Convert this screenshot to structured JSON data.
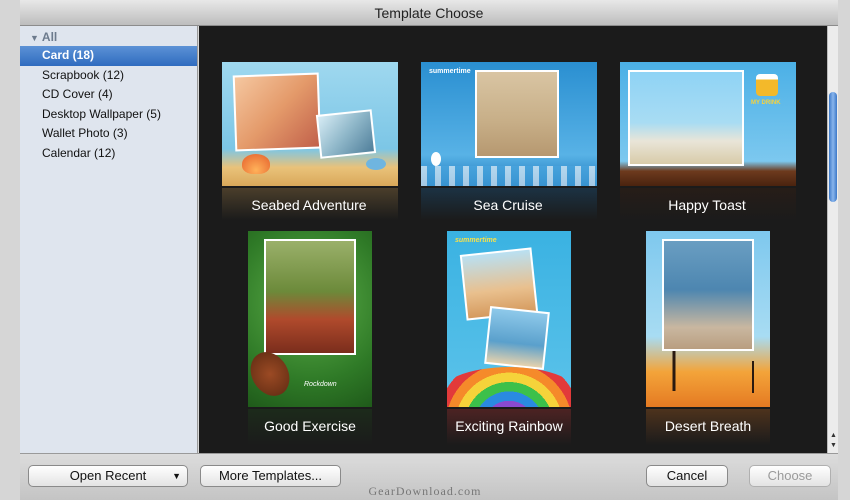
{
  "window": {
    "title": "Template Choose"
  },
  "sidebar": {
    "group_label": "All",
    "items": [
      {
        "label": "Card (18)",
        "selected": true
      },
      {
        "label": "Scrapbook (12)"
      },
      {
        "label": "CD Cover (4)"
      },
      {
        "label": "Desktop Wallpaper (5)"
      },
      {
        "label": "Wallet Photo (3)"
      },
      {
        "label": "Calendar (12)"
      }
    ]
  },
  "templates": [
    {
      "label": "Seabed Adventure"
    },
    {
      "label": "Sea Cruise",
      "text": "summertime"
    },
    {
      "label": "Happy Toast",
      "text": "MY DRINK"
    },
    {
      "label": "Good Exercise",
      "text": "Rockdown"
    },
    {
      "label": "Exciting Rainbow",
      "text": "summertime"
    },
    {
      "label": "Desert Breath"
    }
  ],
  "buttons": {
    "open_recent": "Open Recent",
    "more_templates": "More Templates...",
    "cancel": "Cancel",
    "choose": "Choose"
  },
  "watermark": "GearDownload.com",
  "colors": {
    "selection": "#3a78c9",
    "content_bg": "#1b1b1b",
    "sidebar_bg": "#dfe5ee"
  }
}
